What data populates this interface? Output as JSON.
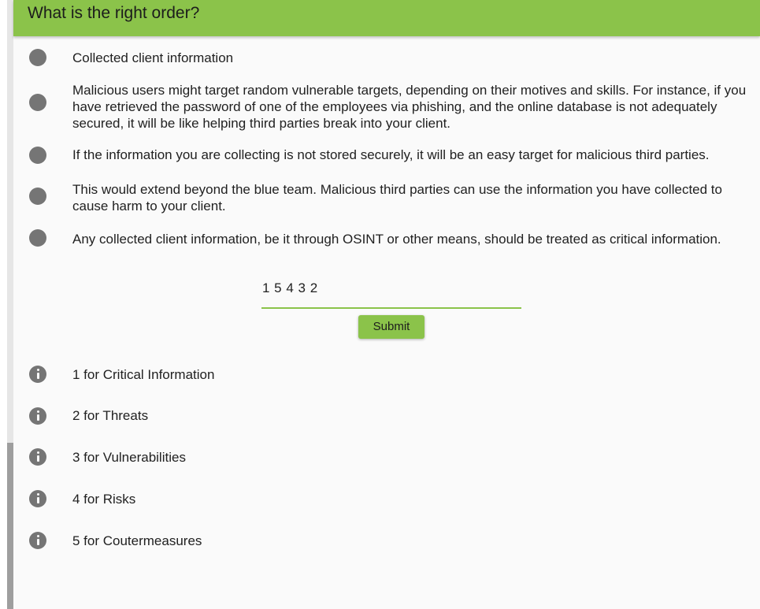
{
  "header": {
    "title": "What is the right order?"
  },
  "options": [
    "Collected client information",
    "Malicious users might target random vulnerable targets, depending on their motives and skills. For instance, if you have retrieved the password of one of the employees via phishing, and the online database is not adequately secured, it will be like helping third parties break into your client.",
    "If the information you are collecting is not stored securely, it will be an easy target for malicious third parties.",
    "This would extend beyond the blue team. Malicious third parties can use the information you have collected to cause harm to your client.",
    "Any collected client information, be it through OSINT or other means, should be treated as critical information."
  ],
  "answer": {
    "value": "1 5 4 3 2"
  },
  "submit_label": "Submit",
  "hints": [
    "1 for Critical Information",
    "2 for Threats",
    "3 for Vulnerabilities",
    "4 for Risks",
    "5 for Coutermeasures"
  ],
  "colors": {
    "accent": "#8bc34a",
    "icon": "#757575"
  },
  "icons": {
    "option": "radio-dot-icon",
    "hint": "info-icon"
  }
}
